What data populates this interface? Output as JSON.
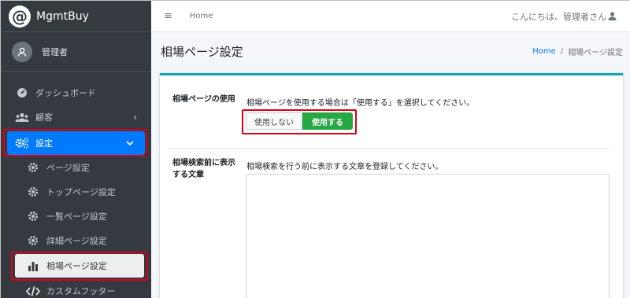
{
  "brand": {
    "logo_char": "@",
    "name": "MgmtBuy"
  },
  "user": {
    "name": "管理者"
  },
  "sidebar": {
    "items": [
      {
        "label": "ダッシュボード"
      },
      {
        "label": "顧客"
      },
      {
        "label": "設定"
      },
      {
        "label": "ページ設定"
      },
      {
        "label": "トップページ設定"
      },
      {
        "label": "一覧ページ設定"
      },
      {
        "label": "詳細ページ設定"
      },
      {
        "label": "相場ページ設定"
      },
      {
        "label": "カスタムフッター"
      }
    ]
  },
  "topbar": {
    "menu_icon": "≡",
    "home_link": "Home",
    "greeting": "こんにちは、管理者さん"
  },
  "header": {
    "title": "相場ページ設定",
    "breadcrumb_home": "Home",
    "breadcrumb_sep": "/",
    "breadcrumb_current": "相場ページ設定"
  },
  "form": {
    "use_page": {
      "label": "相場ページの使用",
      "help": "相場ページを使用する場合は「使用する」を選択してください。",
      "option_off": "使用しない",
      "option_on": "使用する",
      "selected": "使用する"
    },
    "pre_text": {
      "label_line1": "相場検索前に表示",
      "label_line2": "する文章",
      "help": "相場検索を行う前に表示する文章を登録してください。",
      "value": ""
    }
  },
  "colors": {
    "sidebar_bg": "#343a40",
    "active": "#007bff",
    "success": "#28a745",
    "card_top": "#17a2b8",
    "highlight": "#d9001b"
  }
}
